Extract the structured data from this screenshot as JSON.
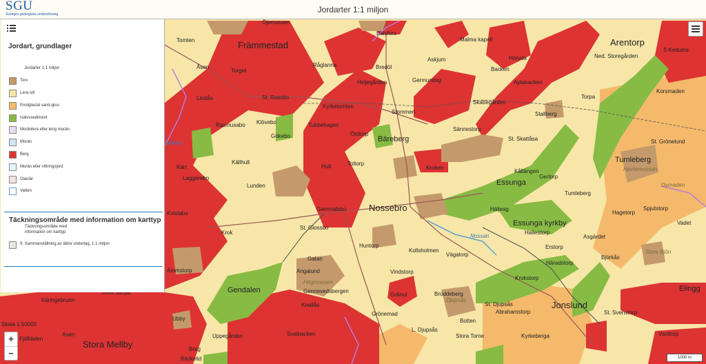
{
  "header": {
    "logo_text": "SGU",
    "logo_subtitle": "Sveriges geologiska undersökning",
    "title": "Jordarter 1:1 miljon"
  },
  "legend": {
    "heading": "Jordart, grundlager",
    "sublayer": "Jordarter 1:1 miljon",
    "items": [
      {
        "label": "Torv",
        "color": "#c49a6c"
      },
      {
        "label": "Lera-silt",
        "color": "#f7e6a8"
      },
      {
        "label": "Postglacial sand-grus",
        "color": "#f4b96b"
      },
      {
        "label": "Isälvssediment",
        "color": "#88bb44"
      },
      {
        "label": "Moränlera eller lerig morän",
        "color": "#e6dcee"
      },
      {
        "label": "Morän",
        "color": "#cfe6f2"
      },
      {
        "label": "Berg",
        "color": "#dd3333"
      },
      {
        "label": "Morän eller vittringsjord",
        "color": "#e0f7fb"
      },
      {
        "label": "Glaciär",
        "color": "#f3e4e4"
      },
      {
        "label": "Vatten",
        "color": "#ffffff"
      }
    ],
    "coverage_heading": "Täckningsområde med information om karttyp",
    "coverage_sub": "Täckningsområde med information om karttyp",
    "coverage_item": {
      "label": "9: Sammanställning av äldre underlag, 1:1 miljon",
      "color": "#e8e6e0"
    }
  },
  "controls": {
    "zoom_in": "+",
    "zoom_out": "−",
    "scale": "Skala 1:50000",
    "scalebar": "1000 m"
  },
  "map_labels": {
    "big": [
      "Främmestad",
      "Arentorp",
      "Nossebro",
      "Jonslund",
      "Stora Mellby",
      "Gendalen",
      "Tumleberg"
    ],
    "medium": [
      "Bäreberg",
      "Essunga",
      "Elingg"
    ],
    "small": [
      "Ryggagården",
      "Ljungagården",
      "Öjemossen",
      "Balsfors",
      "Malma kapell",
      "Tomten",
      "Torget",
      "Åsen",
      "Råglanna",
      "Bredöl",
      "Heljegården",
      "Askjum",
      "Höryda",
      "Backen",
      "S Kedums",
      "Ned. Storegården",
      "Korsmaden",
      "Lindås",
      "St. Rossbo",
      "Kyrketomten",
      "Germundsg",
      "Aplabacken",
      "Skattegården",
      "Torpa",
      "Rasmusabo",
      "Klövebo",
      "Stommen",
      "Stallberg",
      "Tubbehagen",
      "Gökebo",
      "Östtorp",
      "Sännestorp",
      "St. Skattåsa",
      "St. Grönelund",
      "Kärr",
      "Källhult",
      "Hult",
      "Toltorp",
      "Kroken",
      "Kållängen",
      "Gertorp",
      "Lunden",
      "Laggarebo",
      "Gammalsbo",
      "Tumleberg",
      "Hagetorp",
      "Spjutstorp",
      "Kvistabo",
      "Häljesg",
      "Vadet",
      "St. Glossbo",
      "Krok",
      "Hallestorp",
      "Essunga kyrkby",
      "Huntorp",
      "Erstorp",
      "Asgärdet",
      "Kollsholmen",
      "Vägatorp",
      "Björkås",
      "Gatan",
      "Häradstorp",
      "Angalund",
      "Vindstorp",
      "Krokstorp",
      "Grånut",
      "Gennevedsbergen",
      "Broddeberg",
      "St. Djupsås",
      "Knallås",
      "Abrahamstorp",
      "Grönemad",
      "St. Svenstorp",
      "Botten",
      "L. Djupsås",
      "Stora Torne",
      "Kyrkeberga",
      "Svalbacken",
      "Uppegården",
      "Vasttorp",
      "Ubby",
      "Borg",
      "Bäckelid",
      "Övre Jordla",
      "Käringebrunn",
      "Asen",
      "Fjälldalen",
      "Ämmstorp",
      "Ärhe"
    ],
    "italic": [
      "Högmossen",
      "Djupsås",
      "Hjortemossen",
      "Dymaden",
      "Store Bjön",
      "Nossan",
      "Bölken"
    ]
  }
}
